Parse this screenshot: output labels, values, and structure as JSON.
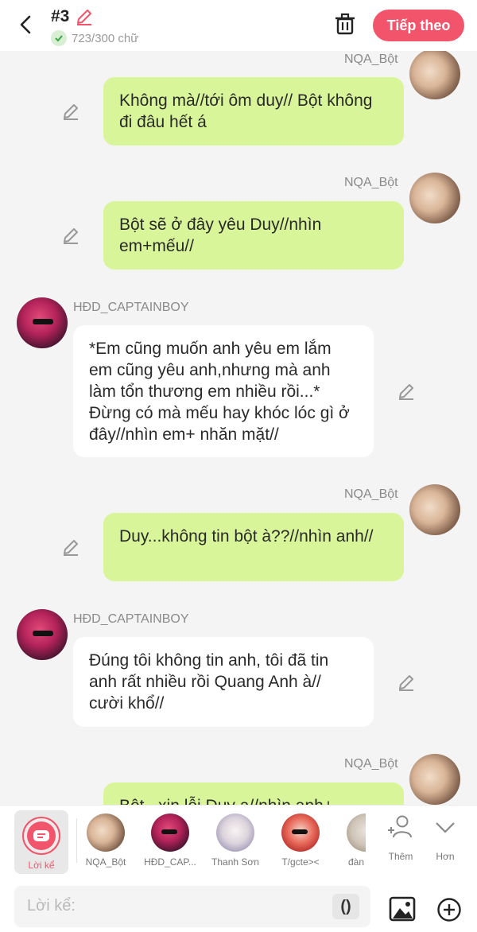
{
  "header": {
    "title": "#3",
    "word_count": "723/300 chữ",
    "next_label": "Tiếp theo"
  },
  "messages": [
    {
      "sender": "NQA_Bột",
      "side": "right",
      "text": "Không mà//tới ôm duy// Bột không đi đâu hết á"
    },
    {
      "sender": "NQA_Bột",
      "side": "right",
      "text": "Bột sẽ ở đây yêu Duy//nhìn em+mếu//"
    },
    {
      "sender": "HĐD_CAPTAINBOY",
      "side": "left",
      "text": "*Em cũng muốn anh yêu em lắm em cũng yêu anh,nhưng mà anh làm tổn thương em nhiều rồi...* Đừng có mà mếu hay khóc lóc gì ở đây//nhìn em+ nhăn mặt//"
    },
    {
      "sender": "NQA_Bột",
      "side": "right",
      "text": "Duy...không tin bột à??//nhìn anh//"
    },
    {
      "sender": "HĐD_CAPTAINBOY",
      "side": "left",
      "text": "Đúng tôi không tin anh, tôi đã tin anh rất nhiều rồi Quang Anh à// cười khổ//"
    },
    {
      "sender": "NQA_Bột",
      "side": "right",
      "text": "Bột...xin lỗi Duy a//nhìn anh+"
    }
  ],
  "characters": {
    "narrator_label": "Lời kể",
    "items": [
      {
        "name": "NQA_Bột"
      },
      {
        "name": "HĐD_CAP..."
      },
      {
        "name": "Thanh Sơn"
      },
      {
        "name": "T/gcte><"
      },
      {
        "name": "đàn"
      }
    ],
    "more_label": "Thêm",
    "less_label": "Hơn"
  },
  "input": {
    "placeholder": "Lời kể:",
    "paren": "()"
  },
  "colors": {
    "accent": "#f2546b",
    "bubble_me": "#d9f59a",
    "bubble_other": "#ffffff"
  }
}
